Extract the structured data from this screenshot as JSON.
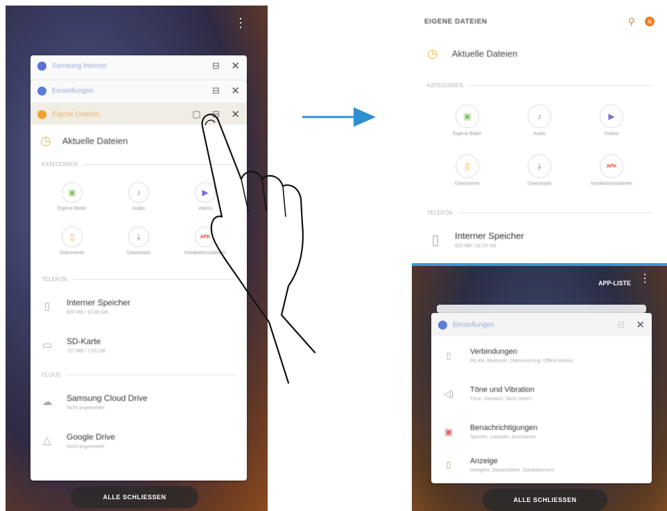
{
  "left": {
    "recents": [
      {
        "title": "Samsung Internet",
        "color": "#5b6fd6"
      },
      {
        "title": "Einstellungen",
        "color": "#5b7dd6"
      }
    ],
    "main_card": {
      "title": "Eigene Dateien",
      "color": "#f3a230",
      "recent_files": "Aktuelle Dateien",
      "categories_header": "KATEGORIEN",
      "categories": [
        {
          "label": "Eigene Bilder",
          "icon": "▣",
          "color": "#8cc46a"
        },
        {
          "label": "Audio",
          "icon": "♪",
          "color": "#888888"
        },
        {
          "label": "Videos",
          "icon": "▶",
          "color": "#7a6fd6"
        },
        {
          "label": "Dokumente",
          "icon": "▯",
          "color": "#f3a230"
        },
        {
          "label": "Downloads",
          "icon": "⤓",
          "color": "#888888"
        },
        {
          "label": "Installationsdateien",
          "icon": "APK",
          "color": "#e04a3a"
        }
      ],
      "phone_header": "TELEFON",
      "storage": [
        {
          "name": "Interner Speicher",
          "detail": "820 MB / 32,00 GB",
          "icon": "▯"
        },
        {
          "name": "SD-Karte",
          "detail": "727 MB / 7,63 GB",
          "icon": "▭"
        }
      ],
      "cloud_header": "CLOUD",
      "cloud": [
        {
          "name": "Samsung Cloud Drive",
          "detail": "Nicht angemeldet",
          "icon": "☁"
        },
        {
          "name": "Google Drive",
          "detail": "Nicht angemeldet",
          "icon": "△"
        }
      ]
    },
    "close_all": "ALLE SCHLIESSEN"
  },
  "right": {
    "title": "EIGENE DATEIEN",
    "badge": "N",
    "recent_files": "Aktuelle Dateien",
    "categories_header": "KATEGORIEN",
    "phone_header": "TELEFON",
    "storage_name": "Interner Speicher",
    "storage_detail": "820 MB / 32,00 GB",
    "app_list": "APP-LISTE",
    "settings_card": {
      "title": "Einstellungen",
      "color": "#5b7dd6",
      "items": [
        {
          "name": "Verbindungen",
          "detail": "WLAN, Bluetooth, Datennutzung, Offline-Modus",
          "icon": "▯"
        },
        {
          "name": "Töne und Vibration",
          "detail": "Töne, Vibration, Nicht stören",
          "icon": "◁)"
        },
        {
          "name": "Benachrichtigungen",
          "detail": "Sperren, zulassen, priorisieren",
          "icon": "▣"
        },
        {
          "name": "Anzeige",
          "detail": "Helligkeit, Blaulichtfilter, Startbildschirm",
          "icon": "▯"
        }
      ]
    },
    "close_all": "ALLE SCHLIESSEN"
  }
}
